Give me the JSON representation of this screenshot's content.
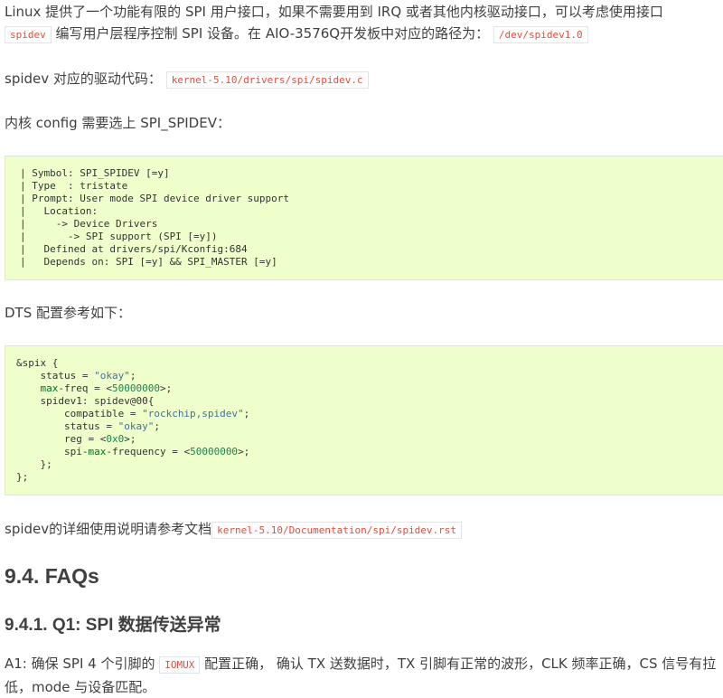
{
  "intro": {
    "text1": "Linux 提供了一个功能有限的 SPI 用户接口，如果不需要用到 IRQ 或者其他内核驱动接口，可以考虑使用接口",
    "code1": "spidev",
    "text2": " 编写用户层程序控制 SPI 设备。在 AIO-3576Q开发板中对应的路径为：",
    "code2": "/dev/spidev1.0"
  },
  "driver": {
    "text": "spidev 对应的驱动代码：",
    "code": "kernel-5.10/drivers/spi/spidev.c"
  },
  "config_label": "内核 config 需要选上 SPI_SPIDEV：",
  "config_block": [
    "| Symbol: SPI_SPIDEV [=y]",
    "| Type  : tristate",
    "| Prompt: User mode SPI device driver support",
    "|   Location:",
    "|     -> Device Drivers",
    "|       -> SPI support (SPI [=y])",
    "|   Defined at drivers/spi/Kconfig:684",
    "|   Depends on: SPI [=y] && SPI_MASTER [=y]"
  ],
  "dts_label": "DTS 配置参考如下：",
  "dts": {
    "l1": "&spix {",
    "l2a": "    status = ",
    "l2b": "\"okay\"",
    "l2c": ";",
    "l3a": "    ",
    "l3b": "max",
    "l3c": "-freq = <",
    "l3d": "50000000",
    "l3e": ">;",
    "l4": "    spidev1: spidev@00{",
    "l5a": "        compatible = ",
    "l5b": "\"rockchip,spidev\"",
    "l5c": ";",
    "l6a": "        status = ",
    "l6b": "\"okay\"",
    "l6c": ";",
    "l7a": "        reg = <",
    "l7b": "0x0",
    "l7c": ">;",
    "l8a": "        spi-",
    "l8b": "max",
    "l8c": "-frequency = <",
    "l8d": "50000000",
    "l8e": ">;",
    "l9": "    };",
    "l10": "};"
  },
  "doc_ref": {
    "text": "spidev的详细使用说明请参考文档",
    "code": "kernel-5.10/Documentation/spi/spidev.rst"
  },
  "faq_heading": "9.4. FAQs",
  "q1_heading": "9.4.1. Q1: SPI 数据传送异常",
  "answer": {
    "text1": "A1: 确保 SPI 4 个引脚的 ",
    "code": "IOMUX",
    "text2": " 配置正确， 确认 TX 送数据时，TX 引脚有正常的波形，CLK 频率正确，CS 信号有拉低，mode 与设备匹配。"
  }
}
